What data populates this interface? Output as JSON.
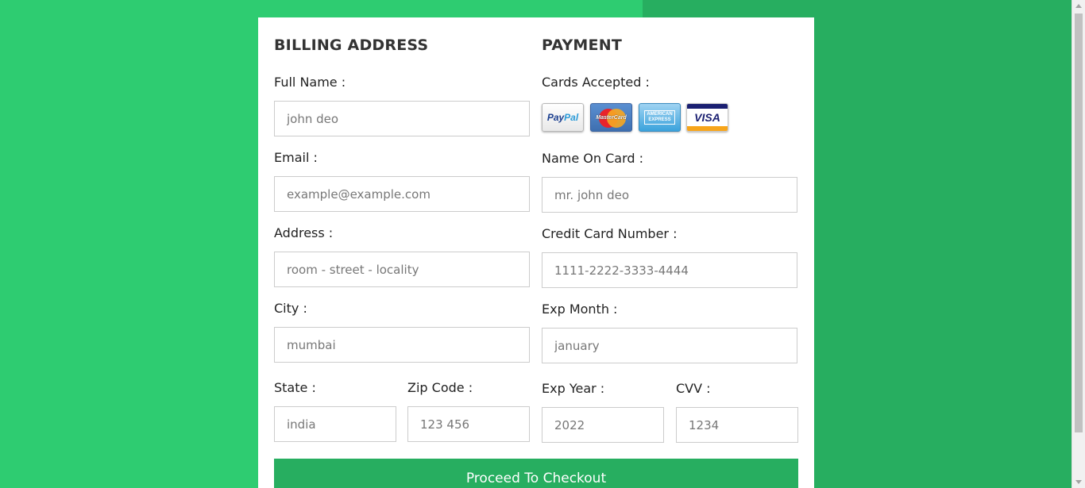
{
  "billing": {
    "title": "BILLING ADDRESS",
    "full_name_label": "Full Name :",
    "full_name_placeholder": "john deo",
    "email_label": "Email :",
    "email_placeholder": "example@example.com",
    "address_label": "Address :",
    "address_placeholder": "room - street - locality",
    "city_label": "City :",
    "city_placeholder": "mumbai",
    "state_label": "State :",
    "state_placeholder": "india",
    "zip_label": "Zip Code :",
    "zip_placeholder": "123 456"
  },
  "payment": {
    "title": "PAYMENT",
    "cards_label": "Cards Accepted :",
    "cards": [
      {
        "name": "paypal-icon",
        "text_a": "Pay",
        "text_b": "Pal"
      },
      {
        "name": "mastercard-icon",
        "text": "MasterCard"
      },
      {
        "name": "amex-icon",
        "line1": "AMERICAN",
        "line2": "EXPRESS"
      },
      {
        "name": "visa-icon",
        "text": "VISA"
      }
    ],
    "name_on_card_label": "Name On Card :",
    "name_on_card_placeholder": "mr. john deo",
    "card_number_label": "Credit Card Number :",
    "card_number_placeholder": "1111-2222-3333-4444",
    "exp_month_label": "Exp Month :",
    "exp_month_placeholder": "january",
    "exp_year_label": "Exp Year :",
    "exp_year_placeholder": "2022",
    "cvv_label": "CVV :",
    "cvv_placeholder": "1234"
  },
  "checkout_label": "Proceed To Checkout",
  "colors": {
    "background_light": "#2ecc71",
    "background_dark": "#27ae60",
    "button": "#27ae60"
  }
}
